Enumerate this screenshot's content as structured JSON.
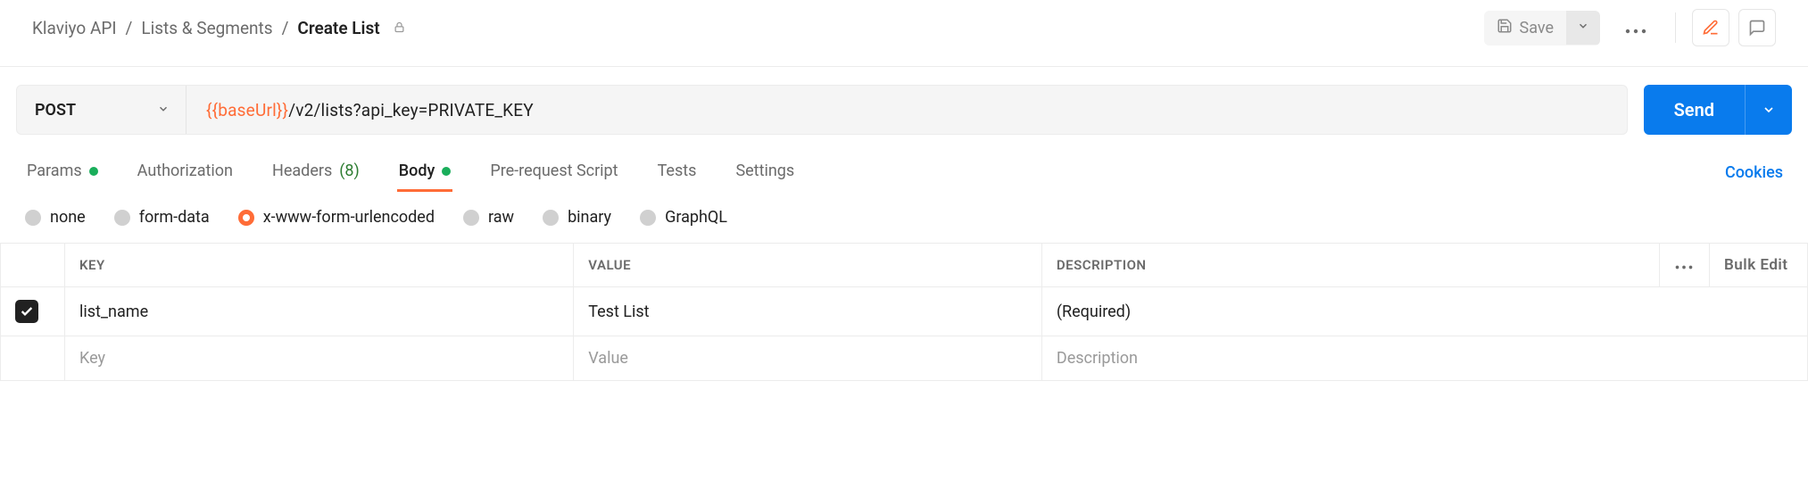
{
  "breadcrumb": {
    "root": "Klaviyo API",
    "mid": "Lists & Segments",
    "current": "Create List"
  },
  "toolbar": {
    "save_label": "Save"
  },
  "request": {
    "method": "POST",
    "url_variable": "{{baseUrl}}",
    "url_path": "/v2/lists?api_key=PRIVATE_KEY"
  },
  "send": {
    "label": "Send"
  },
  "tabs": {
    "params": "Params",
    "authorization": "Authorization",
    "headers": "Headers",
    "headers_count": "(8)",
    "body": "Body",
    "prerequest": "Pre-request Script",
    "tests": "Tests",
    "settings": "Settings",
    "cookies": "Cookies"
  },
  "body_types": {
    "none": "none",
    "formdata": "form-data",
    "xwww": "x-www-form-urlencoded",
    "raw": "raw",
    "binary": "binary",
    "graphql": "GraphQL"
  },
  "table": {
    "headers": {
      "key": "KEY",
      "value": "VALUE",
      "description": "DESCRIPTION"
    },
    "bulk_edit": "Bulk Edit",
    "rows": [
      {
        "key": "list_name",
        "value": "Test List",
        "description": "(Required)"
      }
    ],
    "placeholders": {
      "key": "Key",
      "value": "Value",
      "description": "Description"
    }
  }
}
